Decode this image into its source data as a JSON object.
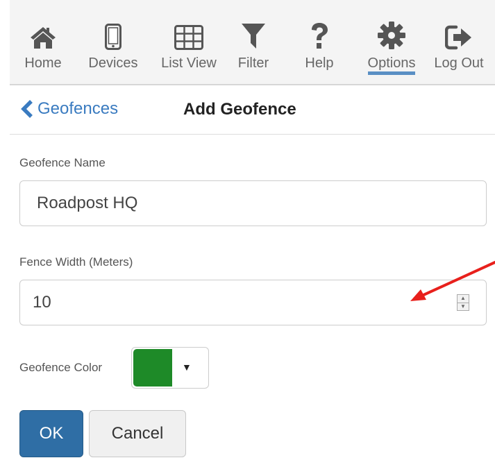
{
  "toolbar": {
    "items": [
      {
        "label": "Home",
        "icon": "home-icon"
      },
      {
        "label": "Devices",
        "icon": "mobile-device-icon"
      },
      {
        "label": "List View",
        "icon": "grid-table-icon"
      },
      {
        "label": "Filter",
        "icon": "filter-funnel-icon"
      },
      {
        "label": "Help",
        "icon": "question-mark-icon"
      },
      {
        "label": "Options",
        "icon": "gear-icon",
        "active": true
      },
      {
        "label": "Log Out",
        "icon": "log-out-icon"
      }
    ],
    "active_color": "#5a8fc4"
  },
  "header": {
    "back_label": "Geofences",
    "title": "Add Geofence",
    "link_color": "#3a7bc0"
  },
  "form": {
    "name_label": "Geofence Name",
    "name_value": "Roadpost HQ",
    "width_label": "Fence Width (Meters)",
    "width_value": "10",
    "color_label": "Geofence Color",
    "color_value": "#1e8a28",
    "ok_label": "OK",
    "cancel_label": "Cancel",
    "ok_color": "#2f6ea5"
  },
  "annotation": {
    "arrow_color": "#e8201c"
  }
}
